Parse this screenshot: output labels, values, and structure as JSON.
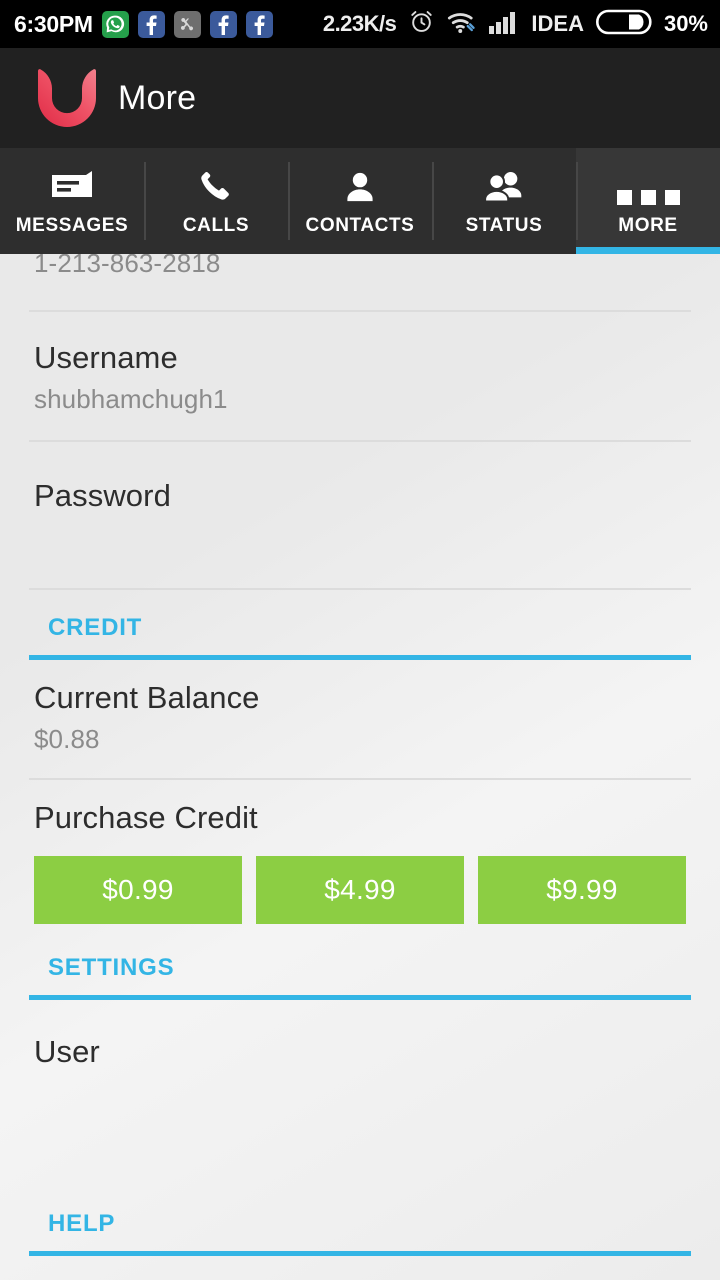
{
  "statusbar": {
    "time": "6:30PM",
    "icons": [
      {
        "name": "whatsapp-icon",
        "glyph": "✆"
      },
      {
        "name": "facebook-icon",
        "glyph": "f"
      },
      {
        "name": "screenshot-icon",
        "glyph": "✂"
      },
      {
        "name": "facebook-icon",
        "glyph": "f"
      },
      {
        "name": "facebook-icon",
        "glyph": "f"
      }
    ],
    "network_speed": "2.23K/s",
    "alarm_icon": "alarm-clock-icon",
    "wifi_icon": "wifi-icon",
    "signal_icon": "signal-bars-icon",
    "carrier": "IDEA",
    "battery_icon": "battery-icon",
    "battery_percent": "30%"
  },
  "actionbar": {
    "logo_name": "app-logo",
    "title": "More"
  },
  "tabs": [
    {
      "label": "MESSAGES",
      "icon": "message-bubble-icon",
      "active": false
    },
    {
      "label": "CALLS",
      "icon": "phone-icon",
      "active": false
    },
    {
      "label": "CONTACTS",
      "icon": "person-icon",
      "active": false
    },
    {
      "label": "STATUS",
      "icon": "people-icon",
      "active": false
    },
    {
      "label": "MORE",
      "icon": "more-dots-icon",
      "active": true
    }
  ],
  "content": {
    "phone_number": "1-213-863-2818",
    "username": {
      "title": "Username",
      "value": "shubhamchugh1"
    },
    "password": {
      "title": "Password"
    },
    "credit_section": {
      "header": "CREDIT",
      "balance": {
        "title": "Current Balance",
        "value": "$0.88"
      },
      "purchase": {
        "title": "Purchase Credit",
        "options": [
          "$0.99",
          "$4.99",
          "$9.99"
        ]
      }
    },
    "settings_section": {
      "header": "SETTINGS",
      "items": [
        {
          "title": "User"
        }
      ]
    },
    "help_section": {
      "header": "HELP"
    }
  },
  "colors": {
    "accent_blue": "#33b5e5",
    "credit_green": "#8cce43",
    "actionbar": "#212121",
    "tabbar": "#2e2e2e",
    "logo_red": "#e8384f"
  }
}
